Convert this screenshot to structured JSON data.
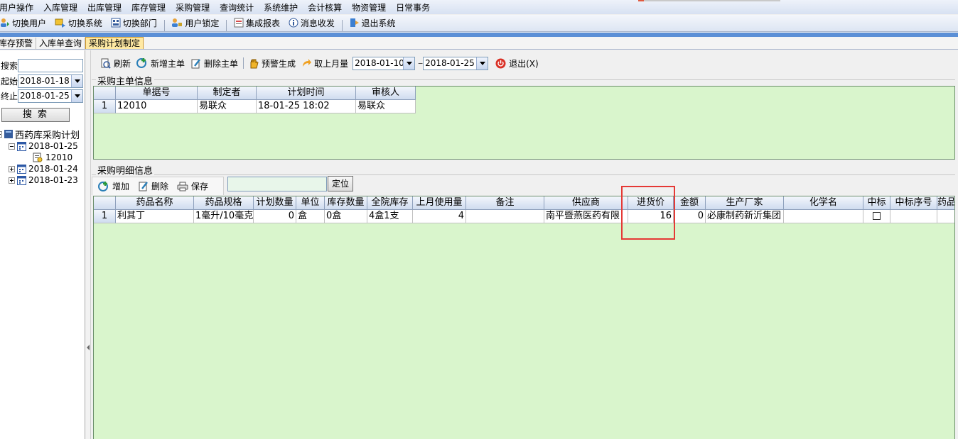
{
  "menu": [
    "用户操作",
    "入库管理",
    "出库管理",
    "库存管理",
    "采购管理",
    "查询统计",
    "系统维护",
    "会计核算",
    "物资管理",
    "日常事务"
  ],
  "toolbar": [
    {
      "label": "切换用户",
      "icon": "switch-user-icon"
    },
    {
      "label": "切换系统",
      "icon": "switch-system-icon"
    },
    {
      "label": "切换部门",
      "icon": "switch-department-icon"
    },
    {
      "label": "用户锁定",
      "icon": "user-lock-icon"
    },
    {
      "label": "集成报表",
      "icon": "report-icon"
    },
    {
      "label": "消息收发",
      "icon": "message-icon"
    },
    {
      "label": "退出系统",
      "icon": "exit-icon"
    }
  ],
  "tabs": [
    "库存预警",
    "入库单查询",
    "采购计划制定"
  ],
  "active_tab": "采购计划制定",
  "left": {
    "search_label": "搜索:",
    "search_value": "",
    "start_label": "起始:",
    "start_value": "2018-01-18",
    "end_label": "终止:",
    "end_value": "2018-01-25",
    "search_button": "搜索",
    "tree_root": "西药库采购计划",
    "tree_nodes": [
      {
        "label": "2018-01-25",
        "expanded": true,
        "children": [
          "12010"
        ]
      },
      {
        "label": "2018-01-24",
        "expanded": false
      },
      {
        "label": "2018-01-23",
        "expanded": false
      }
    ]
  },
  "main_toolbar": {
    "refresh": "刷新",
    "new_master": "新增主单",
    "delete_master": "删除主单",
    "warning_generate": "预警生成",
    "last_month": "取上月量",
    "date_from": "2018-01-10",
    "date_sep": "---",
    "date_to": "2018-01-25",
    "exit": "退出(X)"
  },
  "master": {
    "title": "采购主单信息",
    "columns": [
      "单据号",
      "制定者",
      "计划时间",
      "审核人"
    ],
    "rows": [
      {
        "rownum": "1",
        "cells": [
          "12010",
          "易联众",
          "18-01-25 18:02",
          "易联众"
        ]
      }
    ]
  },
  "detail": {
    "title": "采购明细信息",
    "add": "增加",
    "delete": "删除",
    "save": "保存",
    "locate": "定位",
    "columns": [
      "药品名称",
      "药品规格",
      "计划数量",
      "单位",
      "库存数量",
      "全院库存",
      "上月使用量",
      "备注",
      "供应商",
      "进货价",
      "金额",
      "生产厂家",
      "化学名",
      "中标",
      "中标序号",
      "药品"
    ],
    "rows": [
      {
        "rownum": "1",
        "cells": [
          "利其丁",
          "1毫升/10毫克",
          "0",
          "盒",
          "0盒",
          "4盒1支",
          "4",
          "",
          "南平暨燕医药有限",
          "16",
          "0",
          "必康制药新沂集团",
          "",
          "",
          "",
          ""
        ]
      }
    ]
  },
  "colors": {
    "grid_bg": "#d9f5cc",
    "highlight": "#e53935",
    "tab_active": "#ffe9a3",
    "band": "#5b8fd6"
  }
}
